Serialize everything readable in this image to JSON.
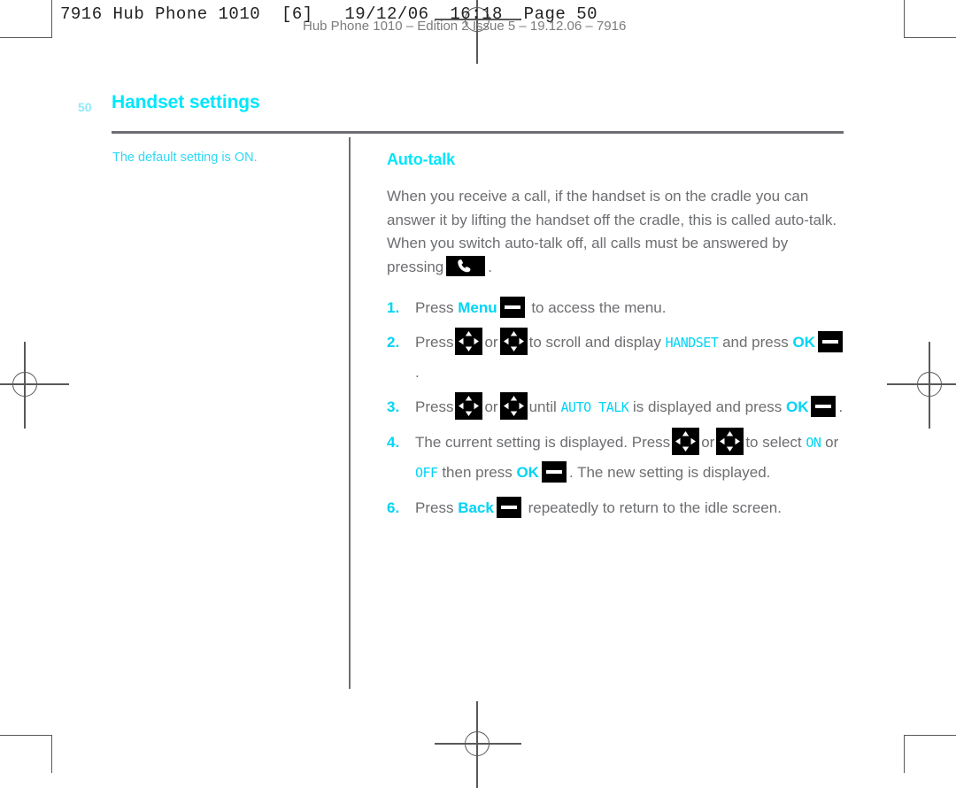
{
  "print_marks": {
    "header_code": "7916 Hub Phone 1010  [6]   19/12/06  16:18  Page 50",
    "footer_imprint": "Hub Phone 1010 – Edition 2 Issue 5 – 19.12.06 – 7916"
  },
  "page": {
    "folio": "50",
    "chapter_title": "Handset settings"
  },
  "side_note": {
    "text": "The default setting is ON."
  },
  "section": {
    "heading": "Auto-talk",
    "paragraph": "When you receive a call, if the handset is on the cradle you can answer it by lifting the handset off the cradle, this is called auto-talk. When you switch auto-talk off, all calls must be answered by pressing",
    "paragraph_tail": "."
  },
  "steps": [
    {
      "num": "1.",
      "pre": "Press",
      "soft_label": "Menu",
      "post": "to access the menu."
    },
    {
      "num": "2.",
      "pre": "Press",
      "mid": "or",
      "post": "to scroll and display",
      "lcd": "HANDSET",
      "post2": "and press",
      "soft_label": "OK",
      "tail": "."
    },
    {
      "num": "3.",
      "pre": "Press",
      "mid": "or",
      "post": "until",
      "lcd": "AUTO TALK",
      "post2": "is displayed and press",
      "soft_label": "OK",
      "tail": "."
    },
    {
      "num": "4.",
      "pre": "The current setting is displayed. Press",
      "mid": "or",
      "post": "to select",
      "lcd_on": "ON",
      "mid2": "or",
      "lcd_off": "OFF",
      "post2": "then press",
      "soft_label": "OK",
      "tail": ". The new setting is displayed."
    },
    {
      "num": "6.",
      "pre": "Press",
      "soft_label": "Back",
      "post": "repeatedly to return to the idle screen."
    }
  ],
  "icons": {
    "softkey": "softkey-icon",
    "navkey": "four-way-navigation-key-icon",
    "phonekey": "talk-phone-key-icon",
    "registration": "registration-mark-icon",
    "crop": "crop-mark-icon"
  },
  "colors": {
    "cyan": "#00e6fb",
    "body_grey": "#6d6e71",
    "key_black": "#000000"
  }
}
